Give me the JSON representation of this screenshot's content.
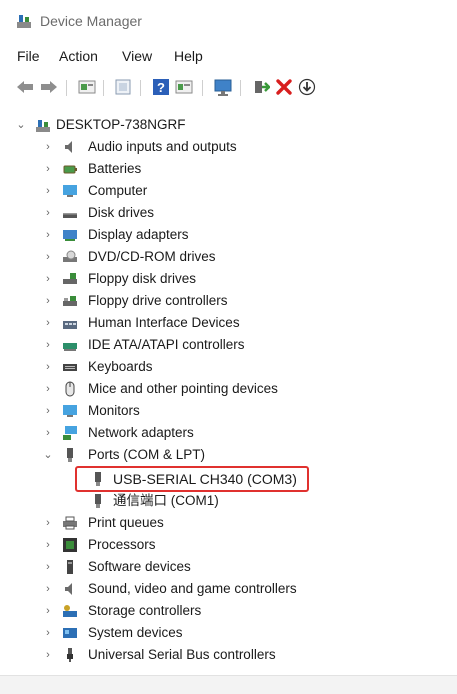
{
  "window": {
    "title": "Device Manager"
  },
  "menu": [
    "File",
    "Action",
    "View",
    "Help"
  ],
  "toolbar": {
    "buttons": [
      "back-icon",
      "forward-icon",
      "properties-icon",
      "update-icon",
      "help-icon",
      "view-icon",
      "scan-hardware-icon",
      "enable-device-icon",
      "uninstall-icon",
      "download-driver-icon"
    ]
  },
  "tree": {
    "root": "DESKTOP-738NGRF",
    "categories": [
      "Audio inputs and outputs",
      "Batteries",
      "Computer",
      "Disk drives",
      "Display adapters",
      "DVD/CD-ROM drives",
      "Floppy disk drives",
      "Floppy drive controllers",
      "Human Interface Devices",
      "IDE ATA/ATAPI controllers",
      "Keyboards",
      "Mice and other pointing devices",
      "Monitors",
      "Network adapters",
      "Ports (COM & LPT)",
      "Print queues",
      "Processors",
      "Software devices",
      "Sound, video and game controllers",
      "Storage controllers",
      "System devices",
      "Universal Serial Bus controllers"
    ],
    "ports_children": [
      "USB-SERIAL CH340 (COM3)",
      "通信端口 (COM1)"
    ]
  },
  "colors": {
    "highlight": "#e0312f",
    "uninstall": "#d81e1e",
    "help": "#2b5fb8"
  }
}
